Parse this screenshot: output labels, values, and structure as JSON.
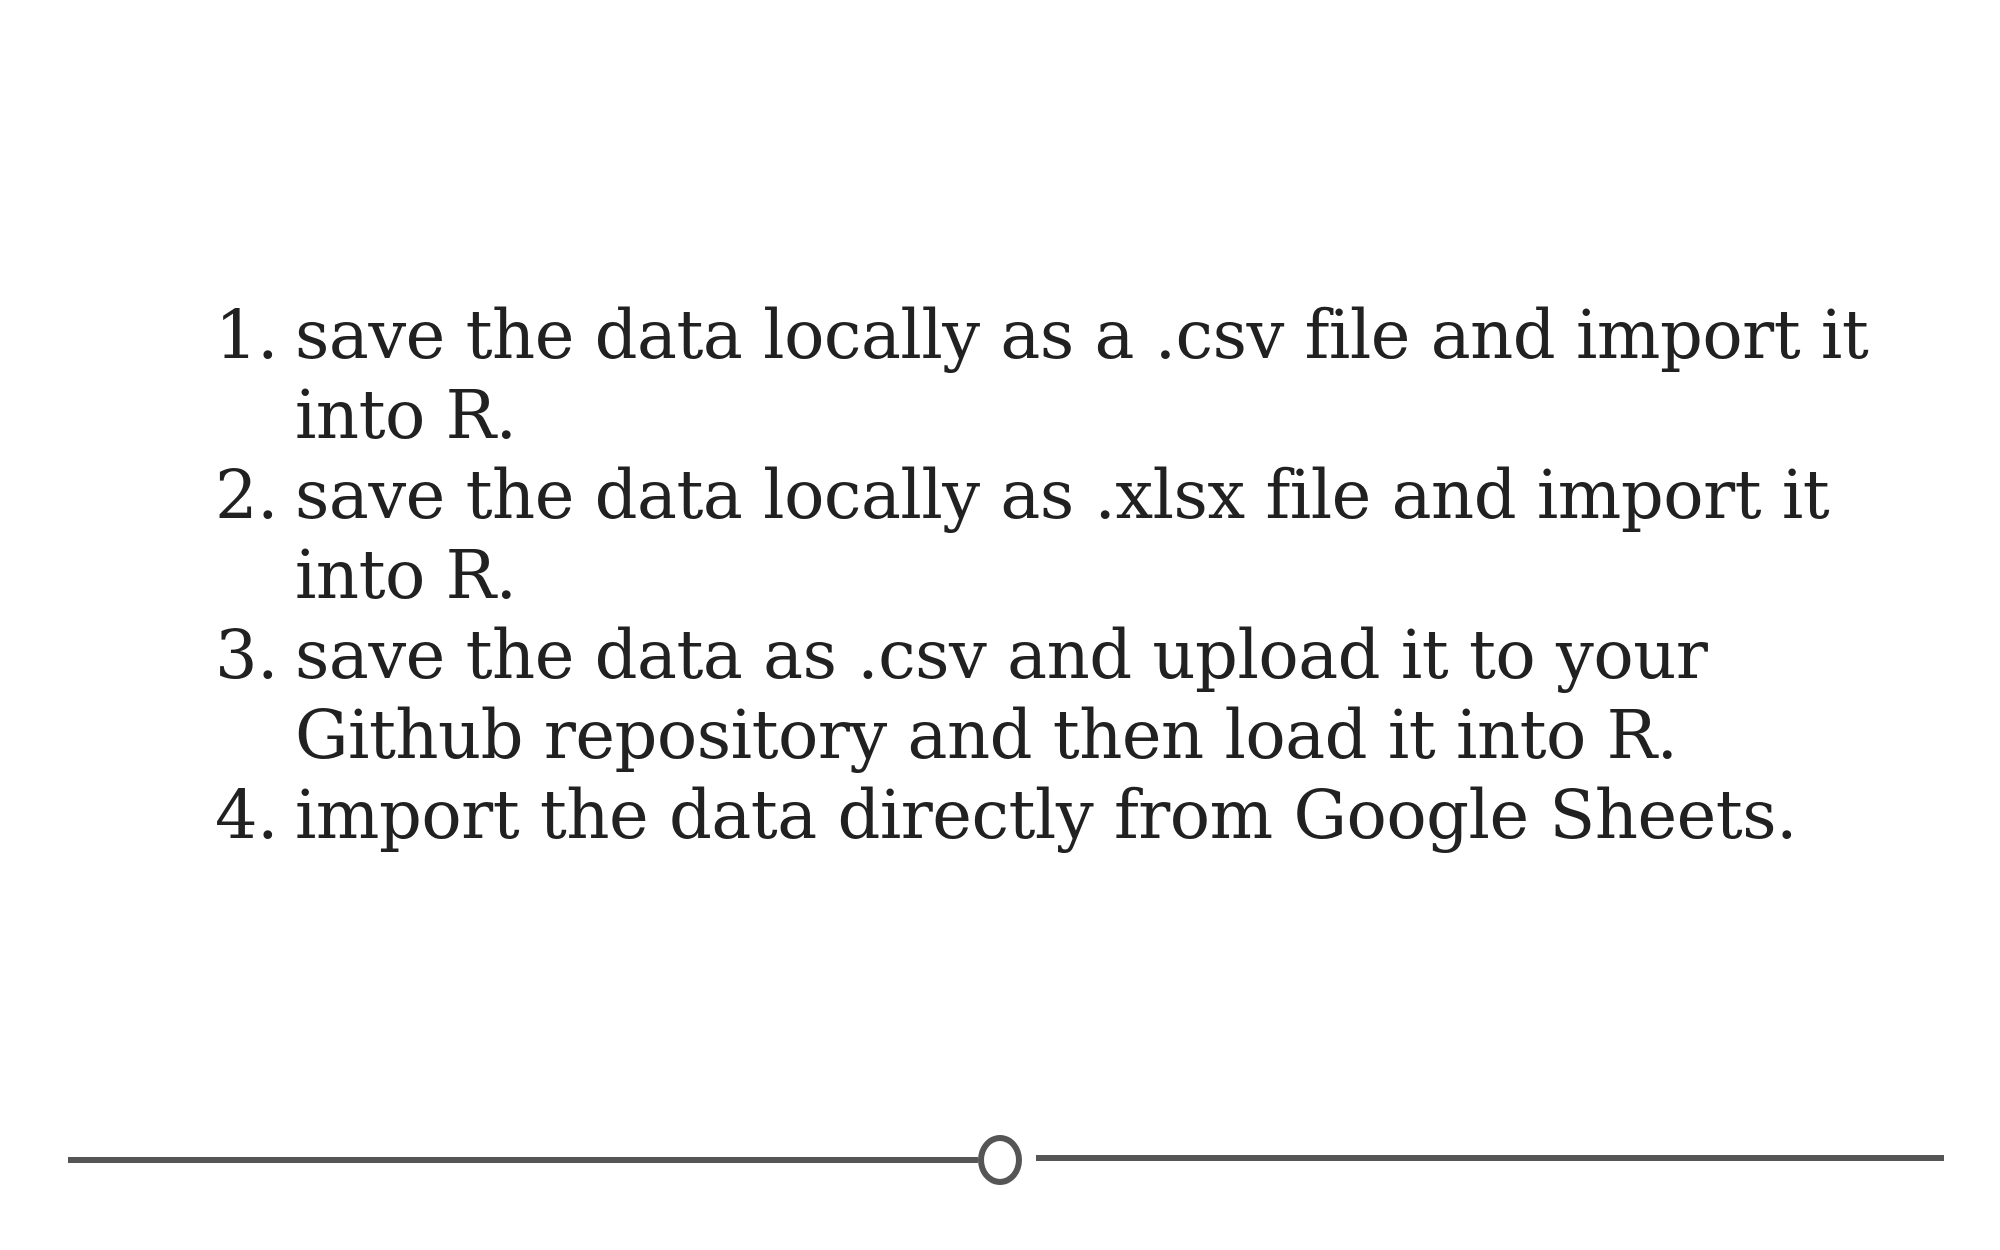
{
  "list": {
    "items": [
      {
        "number": "1.",
        "line1": "save the data locally as a .csv file and import it",
        "line2": "into R."
      },
      {
        "number": "2.",
        "line1": "save the data locally as .xlsx file and import it",
        "line2": "into R."
      },
      {
        "number": "3.",
        "line1": "save the data as .csv and upload it to your",
        "line2": "Github repository and then load it into R."
      },
      {
        "number": "4.",
        "line1": "import the data directly from Google Sheets.",
        "line2": ""
      }
    ]
  },
  "slider": {
    "position_fraction": 0.5
  },
  "colors": {
    "text": "#212121",
    "slider": "#555555",
    "background": "#ffffff"
  }
}
